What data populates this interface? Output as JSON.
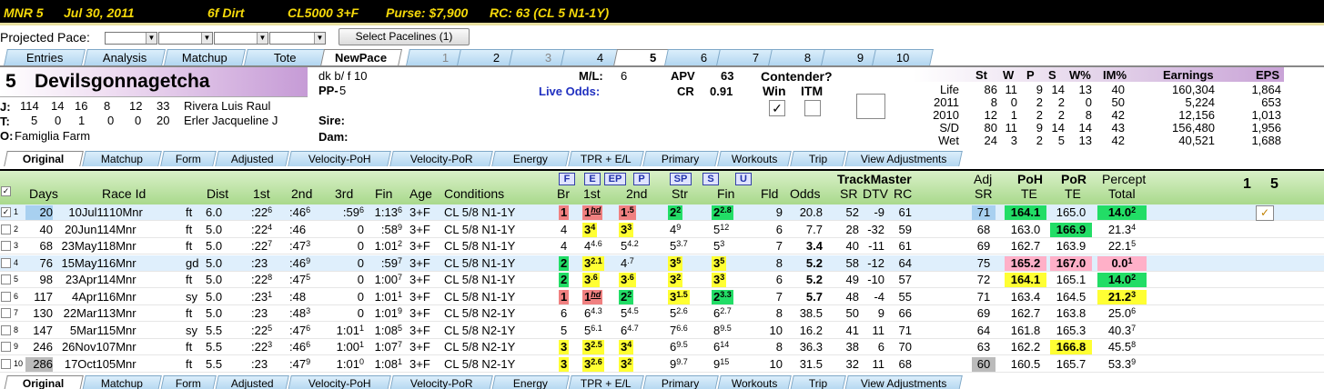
{
  "race_header": {
    "track_num": "MNR  5",
    "date": "Jul 30, 2011",
    "dist": "6f  Dirt",
    "class": "CL5000  3+F",
    "purse": "Purse: $7,900",
    "rc": "RC: 63  (CL 5 N1-1Y)"
  },
  "pace": {
    "label": "Projected Pace:",
    "select_btn": "Select Pacelines  (1)"
  },
  "main_tabs": [
    "Entries",
    "Analysis",
    "Matchup",
    "Tote",
    "NewPace",
    "1",
    "2",
    "3",
    "4",
    "5",
    "6",
    "7",
    "8",
    "9",
    "10"
  ],
  "horse": {
    "post": "5",
    "name": "Devilsgonnagetcha",
    "jockey_label": "J:",
    "jockey_stats": [
      "114",
      "14",
      "16",
      "8",
      "12",
      "33"
    ],
    "jockey_name": "Rivera Luis Raul",
    "trainer_label": "T:",
    "trainer_stats": [
      "5",
      "0",
      "1",
      "0",
      "0",
      "20"
    ],
    "trainer_name": "Erler Jacqueline J",
    "owner_label": "O:",
    "owner": "Famiglia Farm",
    "desc": "dk b/ f 10",
    "pp_label": "PP-",
    "pp": "5",
    "sire_label": "Sire:",
    "dam_label": "Dam:",
    "ml_label": "M/L:",
    "ml": "6",
    "live_odds_label": "Live Odds:",
    "apv_label": "APV",
    "apv": "63",
    "cr_label": "CR",
    "cr": "0.91",
    "contender_label": "Contender?",
    "win_label": "Win",
    "itm_label": "ITM",
    "win_checked": "✓"
  },
  "record": {
    "headers": [
      "St",
      "W",
      "P",
      "S",
      "W%",
      "IM%",
      "Earnings",
      "EPS"
    ],
    "rows": [
      {
        "label": "Life",
        "vals": [
          "86",
          "11",
          "9",
          "14",
          "13",
          "40",
          "160,304",
          "1,864"
        ]
      },
      {
        "label": "2011",
        "vals": [
          "8",
          "0",
          "2",
          "2",
          "0",
          "50",
          "5,224",
          "653"
        ]
      },
      {
        "label": "2010",
        "vals": [
          "12",
          "1",
          "2",
          "2",
          "8",
          "42",
          "12,156",
          "1,013"
        ]
      },
      {
        "label": "S/D",
        "vals": [
          "80",
          "11",
          "9",
          "14",
          "14",
          "43",
          "156,480",
          "1,956"
        ]
      },
      {
        "label": "Wet",
        "vals": [
          "24",
          "3",
          "2",
          "5",
          "13",
          "42",
          "40,521",
          "1,688"
        ]
      }
    ]
  },
  "sub_tabs": [
    "Original",
    "Matchup",
    "Form",
    "Adjusted",
    "Velocity-PoH",
    "Velocity-PoR",
    "Energy",
    "TPR + E/L",
    "Primary",
    "Workouts",
    "Trip",
    "View Adjustments"
  ],
  "filter_buttons": [
    "F",
    "E",
    "EP",
    "P",
    "SP",
    "S",
    "U"
  ],
  "columns": {
    "days": "Days",
    "race_id": "Race Id",
    "dist": "Dist",
    "first": "1st",
    "second": "2nd",
    "third": "3rd",
    "fin": "Fin",
    "age": "Age",
    "cond": "Conditions",
    "br": "Br",
    "c1": "1st",
    "c2": "2nd",
    "str": "Str",
    "cfin": "Fin",
    "fld": "Fld",
    "odds": "Odds",
    "tm": "TrackMaster",
    "sr": "SR",
    "dtv": "DTV",
    "rc": "RC",
    "adj": "Adj",
    "adjsr": "SR",
    "poh": "PoH",
    "pohte": "TE",
    "por": "PoR",
    "porte": "TE",
    "percept": "Percept",
    "total": "Total",
    "col1": "1",
    "col5": "5"
  },
  "rows": [
    {
      "n": "1",
      "chk": "✓",
      "days": "20",
      "date": "10Jul11",
      "race": "10Mnr",
      "cond": "ft",
      "dist": "6.0",
      "f1": ":22",
      "f1s": "6",
      "f2": ":46",
      "f2s": "6",
      "f3": ":59",
      "f3s": "6",
      "fin": "1:13",
      "fins": "6",
      "age": "3+F",
      "conds": "CL 5/8 N1-1Y",
      "br": "1",
      "br_c": "red",
      "p1": "1",
      "p1s": "hd",
      "p1_c": "red",
      "p2": "1",
      "p2s": ".5",
      "p2_c": "red",
      "st": "2",
      "sts": "2",
      "st_c": "grn",
      "fn": "2",
      "fns": "2.8",
      "fn_c": "grn",
      "fld": "9",
      "odds": "20.8",
      "odds_b": false,
      "sr": "52",
      "dtv": "-9",
      "rc": "61",
      "adj": "71",
      "adj_c": "blu",
      "poh": "164.1",
      "poh_c": "grn",
      "por": "165.0",
      "por_c": "",
      "pt": "14.0",
      "pts": "2",
      "pt_c": "grn",
      "sel": true
    },
    {
      "n": "2",
      "chk": "",
      "days": "40",
      "date": "20Jun11",
      "race": "4Mnr",
      "cond": "ft",
      "dist": "5.0",
      "f1": ":22",
      "f1s": "4",
      "f2": ":46",
      "f2s": "",
      "f3": "0",
      "f3s": "",
      "fin": ":58",
      "fins": "9",
      "age": "3+F",
      "conds": "CL 5/8 N1-1Y",
      "br": "4",
      "br_c": "",
      "p1": "3",
      "p1s": "4",
      "p1_c": "yel",
      "p2": "3",
      "p2s": "3",
      "p2_c": "yel",
      "st": "4",
      "sts": "9",
      "st_c": "",
      "fn": "5",
      "fns": "12",
      "fn_c": "",
      "fld": "6",
      "odds": "7.7",
      "odds_b": false,
      "sr": "28",
      "dtv": "-32",
      "rc": "59",
      "adj": "68",
      "adj_c": "",
      "poh": "163.0",
      "poh_c": "",
      "por": "166.9",
      "por_c": "grn",
      "pt": "21.3",
      "pts": "4",
      "pt_c": "",
      "sel": false
    },
    {
      "n": "3",
      "chk": "",
      "days": "68",
      "date": "23May11",
      "race": "8Mnr",
      "cond": "ft",
      "dist": "5.0",
      "f1": ":22",
      "f1s": "7",
      "f2": ":47",
      "f2s": "3",
      "f3": "0",
      "f3s": "",
      "fin": "1:01",
      "fins": "2",
      "age": "3+F",
      "conds": "CL 5/8 N1-1Y",
      "br": "4",
      "br_c": "",
      "p1": "4",
      "p1s": "4.6",
      "p1_c": "",
      "p2": "5",
      "p2s": "4.2",
      "p2_c": "",
      "st": "5",
      "sts": "3.7",
      "st_c": "",
      "fn": "5",
      "fns": "3",
      "fn_c": "",
      "fld": "7",
      "odds": "3.4",
      "odds_b": true,
      "sr": "40",
      "dtv": "-11",
      "rc": "61",
      "adj": "69",
      "adj_c": "",
      "poh": "162.7",
      "poh_c": "",
      "por": "163.9",
      "por_c": "",
      "pt": "22.1",
      "pts": "5",
      "pt_c": "",
      "sel": false
    },
    {
      "n": "4",
      "chk": "",
      "days": "76",
      "date": "15May11",
      "race": "6Mnr",
      "cond": "gd",
      "dist": "5.0",
      "f1": ":23",
      "f1s": "",
      "f2": ":46",
      "f2s": "9",
      "f3": "0",
      "f3s": "",
      "fin": ":59",
      "fins": "7",
      "age": "3+F",
      "conds": "CL 5/8 N1-1Y",
      "br": "2",
      "br_c": "grn",
      "p1": "3",
      "p1s": "2.1",
      "p1_c": "yel",
      "p2": "4",
      "p2s": ".7",
      "p2_c": "",
      "st": "3",
      "sts": "5",
      "st_c": "yel",
      "fn": "3",
      "fns": "5",
      "fn_c": "yel",
      "fld": "8",
      "odds": "5.2",
      "odds_b": true,
      "sr": "58",
      "dtv": "-12",
      "rc": "64",
      "adj": "75",
      "adj_c": "",
      "poh": "165.2",
      "poh_c": "pink",
      "por": "167.0",
      "por_c": "pink",
      "pt": "0.0",
      "pts": "1",
      "pt_c": "pink",
      "sel": true
    },
    {
      "n": "5",
      "chk": "",
      "days": "98",
      "date": "23Apr11",
      "race": "4Mnr",
      "cond": "ft",
      "dist": "5.0",
      "f1": ":22",
      "f1s": "8",
      "f2": ":47",
      "f2s": "5",
      "f3": "0",
      "f3s": "",
      "fin": "1:00",
      "fins": "7",
      "age": "3+F",
      "conds": "CL 5/8 N1-1Y",
      "br": "2",
      "br_c": "grn",
      "p1": "3",
      "p1s": ".6",
      "p1_c": "yel",
      "p2": "3",
      "p2s": ".6",
      "p2_c": "yel",
      "st": "3",
      "sts": "2",
      "st_c": "yel",
      "fn": "3",
      "fns": "3",
      "fn_c": "yel",
      "fld": "6",
      "odds": "5.2",
      "odds_b": true,
      "sr": "49",
      "dtv": "-10",
      "rc": "57",
      "adj": "72",
      "adj_c": "",
      "poh": "164.1",
      "poh_c": "yel",
      "por": "165.1",
      "por_c": "",
      "pt": "14.0",
      "pts": "2",
      "pt_c": "grn",
      "sel": false
    },
    {
      "n": "6",
      "chk": "",
      "days": "117",
      "date": "4Apr11",
      "race": "6Mnr",
      "cond": "sy",
      "dist": "5.0",
      "f1": ":23",
      "f1s": "1",
      "f2": ":48",
      "f2s": "",
      "f3": "0",
      "f3s": "",
      "fin": "1:01",
      "fins": "1",
      "age": "3+F",
      "conds": "CL 5/8 N1-1Y",
      "br": "1",
      "br_c": "red",
      "p1": "1",
      "p1s": "hd",
      "p1_c": "red",
      "p2": "2",
      "p2s": "2",
      "p2_c": "grn",
      "st": "3",
      "sts": "1.5",
      "st_c": "yel",
      "fn": "2",
      "fns": "3.3",
      "fn_c": "grn",
      "fld": "7",
      "odds": "5.7",
      "odds_b": true,
      "sr": "48",
      "dtv": "-4",
      "rc": "55",
      "adj": "71",
      "adj_c": "",
      "poh": "163.4",
      "poh_c": "",
      "por": "164.5",
      "por_c": "",
      "pt": "21.2",
      "pts": "3",
      "pt_c": "yel",
      "sel": false
    },
    {
      "n": "7",
      "chk": "",
      "days": "130",
      "date": "22Mar11",
      "race": "3Mnr",
      "cond": "ft",
      "dist": "5.0",
      "f1": ":23",
      "f1s": "",
      "f2": ":48",
      "f2s": "3",
      "f3": "0",
      "f3s": "",
      "fin": "1:01",
      "fins": "9",
      "age": "3+F",
      "conds": "CL 5/8 N2-1Y",
      "br": "6",
      "br_c": "",
      "p1": "6",
      "p1s": "4.3",
      "p1_c": "",
      "p2": "5",
      "p2s": "4.5",
      "p2_c": "",
      "st": "5",
      "sts": "2.6",
      "st_c": "",
      "fn": "6",
      "fns": "2.7",
      "fn_c": "",
      "fld": "8",
      "odds": "38.5",
      "odds_b": false,
      "sr": "50",
      "dtv": "9",
      "rc": "66",
      "adj": "69",
      "adj_c": "",
      "poh": "162.7",
      "poh_c": "",
      "por": "163.8",
      "por_c": "",
      "pt": "25.0",
      "pts": "6",
      "pt_c": "",
      "sel": false
    },
    {
      "n": "8",
      "chk": "",
      "days": "147",
      "date": "5Mar11",
      "race": "5Mnr",
      "cond": "sy",
      "dist": "5.5",
      "f1": ":22",
      "f1s": "5",
      "f2": ":47",
      "f2s": "6",
      "f3": "1:01",
      "f3s": "1",
      "fin": "1:08",
      "fins": "5",
      "age": "3+F",
      "conds": "CL 5/8 N2-1Y",
      "br": "5",
      "br_c": "",
      "p1": "5",
      "p1s": "6.1",
      "p1_c": "",
      "p2": "6",
      "p2s": "4.7",
      "p2_c": "",
      "st": "7",
      "sts": "6.6",
      "st_c": "",
      "fn": "8",
      "fns": "9.5",
      "fn_c": "",
      "fld": "10",
      "odds": "16.2",
      "odds_b": false,
      "sr": "41",
      "dtv": "11",
      "rc": "71",
      "adj": "64",
      "adj_c": "",
      "poh": "161.8",
      "poh_c": "",
      "por": "165.3",
      "por_c": "",
      "pt": "40.3",
      "pts": "7",
      "pt_c": "",
      "sel": false
    },
    {
      "n": "9",
      "chk": "",
      "days": "246",
      "date": "26Nov10",
      "race": "7Mnr",
      "cond": "ft",
      "dist": "5.5",
      "f1": ":22",
      "f1s": "3",
      "f2": ":46",
      "f2s": "6",
      "f3": "1:00",
      "f3s": "1",
      "fin": "1:07",
      "fins": "7",
      "age": "3+F",
      "conds": "CL 5/8 N2-1Y",
      "br": "3",
      "br_c": "yel",
      "p1": "3",
      "p1s": "2.5",
      "p1_c": "yel",
      "p2": "3",
      "p2s": "4",
      "p2_c": "yel",
      "st": "6",
      "sts": "9.5",
      "st_c": "",
      "fn": "6",
      "fns": "14",
      "fn_c": "",
      "fld": "8",
      "odds": "36.3",
      "odds_b": false,
      "sr": "38",
      "dtv": "6",
      "rc": "70",
      "adj": "63",
      "adj_c": "",
      "poh": "162.2",
      "poh_c": "",
      "por": "166.8",
      "por_c": "yel",
      "pt": "45.5",
      "pts": "8",
      "pt_c": "",
      "sel": false
    },
    {
      "n": "10",
      "chk": "",
      "days": "286",
      "date": "17Oct10",
      "race": "5Mnr",
      "cond": "ft",
      "dist": "5.5",
      "f1": ":23",
      "f1s": "",
      "f2": ":47",
      "f2s": "9",
      "f3": "1:01",
      "f3s": "0",
      "fin": "1:08",
      "fins": "1",
      "age": "3+F",
      "conds": "CL 5/8 N2-1Y",
      "br": "3",
      "br_c": "yel",
      "p1": "3",
      "p1s": "2.6",
      "p1_c": "yel",
      "p2": "3",
      "p2s": "2",
      "p2_c": "yel",
      "st": "9",
      "sts": "9.7",
      "st_c": "",
      "fn": "9",
      "fns": "15",
      "fn_c": "",
      "fld": "10",
      "odds": "31.5",
      "odds_b": false,
      "sr": "32",
      "dtv": "11",
      "rc": "68",
      "adj": "60",
      "adj_c": "gry",
      "poh": "160.5",
      "poh_c": "",
      "por": "165.7",
      "por_c": "",
      "pt": "53.3",
      "pts": "9",
      "pt_c": "",
      "sel": false
    }
  ],
  "colors": {
    "top_bg": "#000000",
    "top_text": "#f5d90a",
    "header_band": "#a9d98c",
    "red": "#f08080",
    "yellow": "#ffff33",
    "green": "#22dd66",
    "pink": "#ffb0c8",
    "blue": "#a8d0f0"
  }
}
